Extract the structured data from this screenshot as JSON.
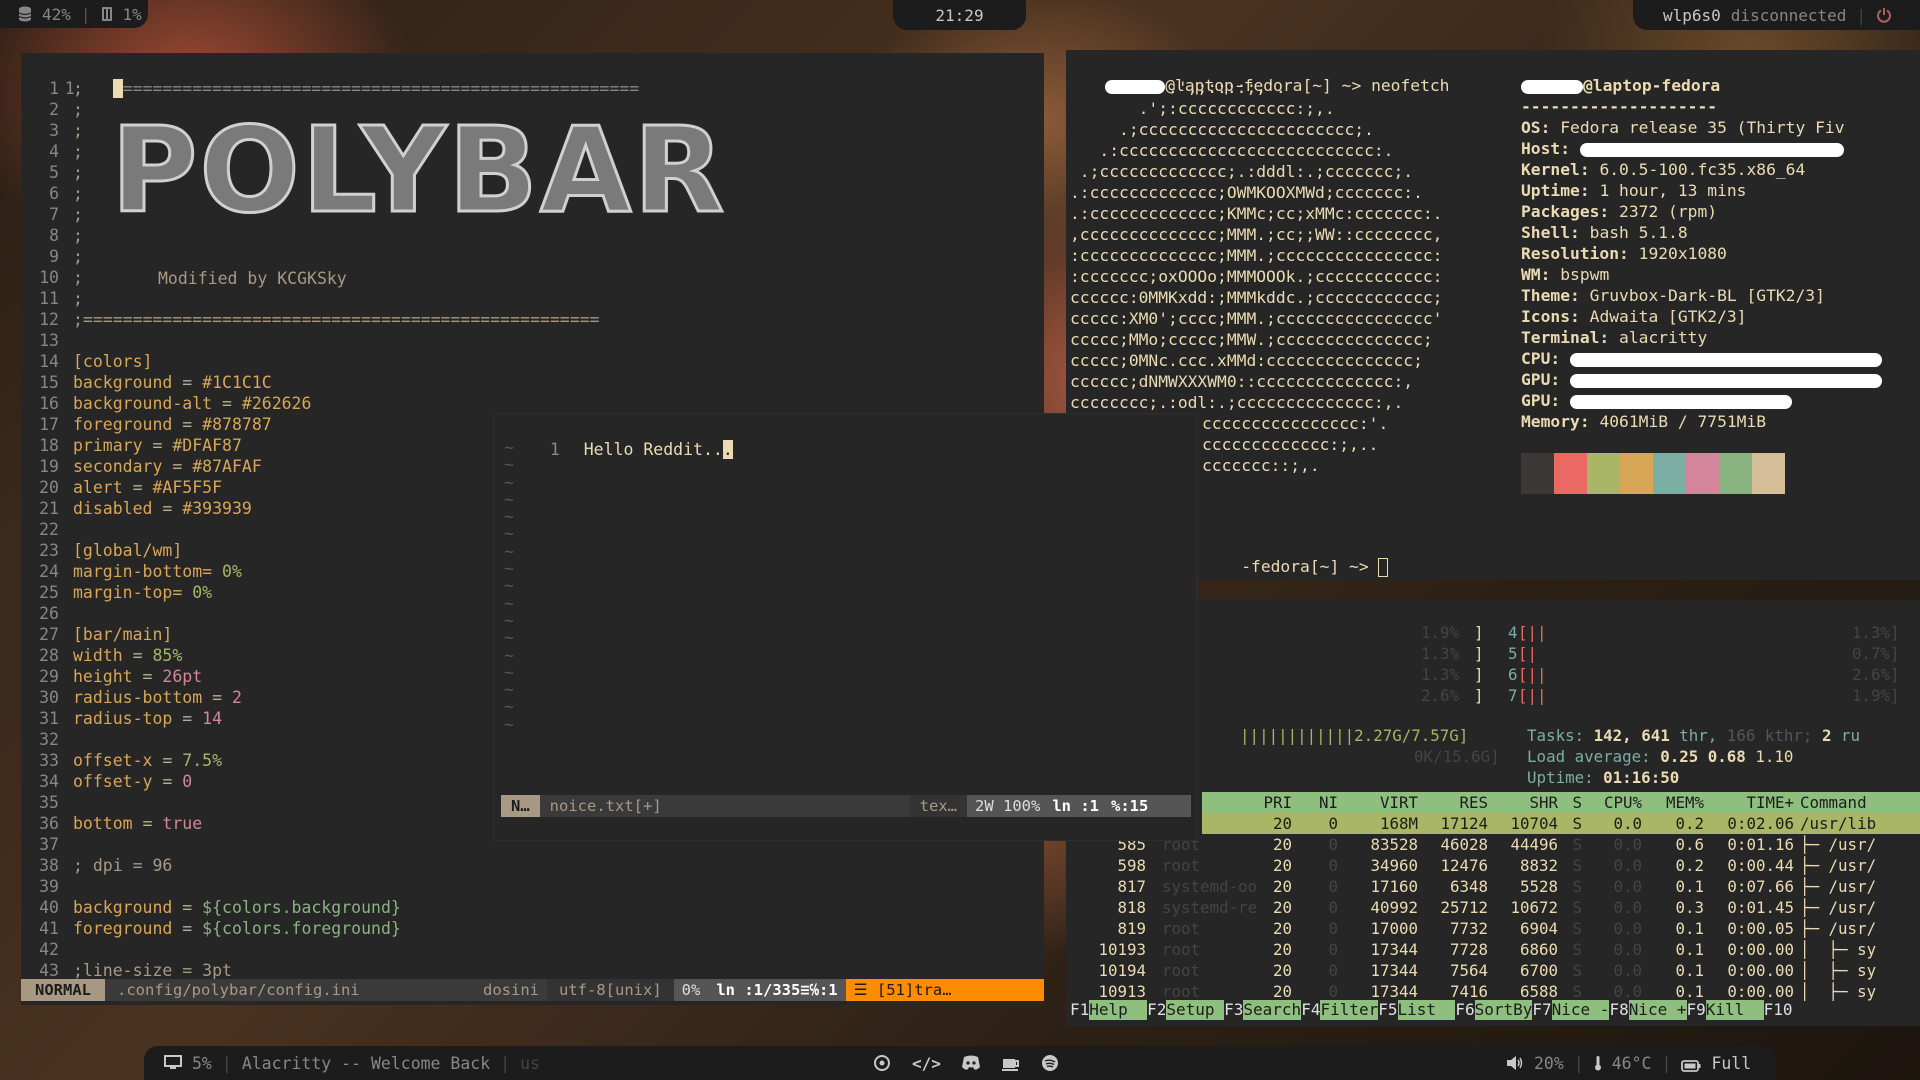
{
  "topbar": {
    "disk_pct": "42%",
    "mem_pct": "1%",
    "clock": "21:29",
    "network": "wlp6s0",
    "network_state": "disconnected"
  },
  "editor": {
    "header_line_number": "1",
    "header_rule": "====================================================",
    "art_text": "POLYBAR",
    "modified_by": "Modified by KCGKSky",
    "lines": [
      {
        "n": "1",
        "t": ";"
      },
      {
        "n": "2",
        "t": ";"
      },
      {
        "n": "3",
        "t": ";"
      },
      {
        "n": "4",
        "t": ";"
      },
      {
        "n": "5",
        "t": ";"
      },
      {
        "n": "6",
        "t": ";"
      },
      {
        "n": "7",
        "t": ";"
      },
      {
        "n": "8",
        "t": ";"
      },
      {
        "n": "9",
        "t": ";"
      },
      {
        "n": "10",
        "t": ";"
      },
      {
        "n": "11",
        "t": ";"
      },
      {
        "n": "12",
        "t": ";===================================================="
      },
      {
        "n": "13",
        "t": ""
      },
      {
        "n": "14",
        "t": "[colors]"
      },
      {
        "n": "15",
        "key": "background",
        "val": "#1C1C1C"
      },
      {
        "n": "16",
        "key": "background-alt",
        "val": "#262626"
      },
      {
        "n": "17",
        "key": "foreground",
        "val": "#878787"
      },
      {
        "n": "18",
        "key": "primary",
        "val": "#DFAF87"
      },
      {
        "n": "19",
        "key": "secondary",
        "val": "#87AFAF"
      },
      {
        "n": "20",
        "key": "alert",
        "val": "#AF5F5F"
      },
      {
        "n": "21",
        "key": "disabled",
        "val": "#393939"
      },
      {
        "n": "22",
        "t": ""
      },
      {
        "n": "23",
        "t": "[global/wm]"
      },
      {
        "n": "24",
        "key": "margin-bottom=",
        "val": "0%"
      },
      {
        "n": "25",
        "key": "margin-top=",
        "val": "0%"
      },
      {
        "n": "26",
        "t": ""
      },
      {
        "n": "27",
        "t": "[bar/main]"
      },
      {
        "n": "28",
        "key": "width",
        "val": "85%"
      },
      {
        "n": "29",
        "key": "height",
        "val": "26pt"
      },
      {
        "n": "30",
        "key": "radius-bottom",
        "val": "2"
      },
      {
        "n": "31",
        "key": "radius-top",
        "val": "14"
      },
      {
        "n": "32",
        "t": ""
      },
      {
        "n": "33",
        "key": "offset-x",
        "val": "7.5%"
      },
      {
        "n": "34",
        "key": "offset-y",
        "val": "0"
      },
      {
        "n": "35",
        "t": ""
      },
      {
        "n": "36",
        "key": "bottom",
        "val": "true"
      },
      {
        "n": "37",
        "t": ""
      },
      {
        "n": "38",
        "t": "; dpi = 96"
      },
      {
        "n": "39",
        "t": ""
      },
      {
        "n": "40",
        "key": "background",
        "val": "${colors.background}"
      },
      {
        "n": "41",
        "key": "foreground",
        "val": "${colors.foreground}"
      },
      {
        "n": "42",
        "t": ""
      },
      {
        "n": "43",
        "t": ";line-size = 3pt"
      }
    ],
    "status": {
      "mode": "NORMAL",
      "file": ".config/polybar/config.ini",
      "filetype": "dosini",
      "encoding": "utf-8[unix]",
      "percent": "0%",
      "position": "ln :1/335≡℅:1",
      "warning": "☰ [51]tra…"
    }
  },
  "float_editor": {
    "line_number": "1",
    "text": "Hello Reddit..",
    "cursor_char": ".",
    "tilde": "~",
    "status": {
      "mode": "N…",
      "file": "noice.txt[+]",
      "filetype": "tex…",
      "info": "2W 100%",
      "position": "ln :1",
      "col": "%:15"
    }
  },
  "neofetch": {
    "prompt": "@laptop-fedora[~] ~> neofetch",
    "prompt2": "-fedora[~] ~>",
    "userhost": "@laptop-fedora",
    "separator": "--------------------",
    "logo": [
      "          .',;::::;,'.",
      "       .';:cccccccccccc:;,.",
      "     .;cccccccccccccccccccccc;.",
      "   .:cccccccccccccccccccccccccc:.",
      " .;ccccccccccccc;.:dddl:.;ccccccc;.",
      ".:ccccccccccccc;OWMKOOXMWd;ccccccc:.",
      ".:ccccccccccccc;KMMc;cc;xMMc:ccccccc:.",
      ",cccccccccccccc;MMM.;cc;;WW::cccccccc,",
      ":cccccccccccccc;MMM.;cccccccccccccccc:",
      ":ccccccc;oxOOOo;MMMOOOk.;cccccccccccc:",
      "cccccc:0MMKxdd:;MMMkddc.;cccccccccccc;",
      "ccccc:XM0';cccc;MMM.;cccccccccccccccc'",
      "ccccc;MMo;ccccc;MMW.;ccccccccccccccc;",
      "ccccc;0MNc.ccc.xMMd:ccccccccccccccc;",
      "cccccc;dNMWXXXWM0::cccccccccccccc:,",
      "cccccccc;.:odl:.;cccccccccccccc:,."
    ],
    "logo_tail": [
      "cccccccccccccccc:'.",
      "ccccccccccccc:;,..",
      "ccccccc::;,."
    ],
    "info": [
      {
        "label": "OS:",
        "val": "Fedora release 35 (Thirty Fiv"
      },
      {
        "label": "Host:",
        "val": ""
      },
      {
        "label": "Kernel:",
        "val": "6.0.5-100.fc35.x86_64"
      },
      {
        "label": "Uptime:",
        "val": "1 hour, 13 mins"
      },
      {
        "label": "Packages:",
        "val": "2372 (rpm)"
      },
      {
        "label": "Shell:",
        "val": "bash 5.1.8"
      },
      {
        "label": "Resolution:",
        "val": "1920x1080"
      },
      {
        "label": "WM:",
        "val": "bspwm"
      },
      {
        "label": "Theme:",
        "val": "Gruvbox-Dark-BL [GTK2/3]"
      },
      {
        "label": "Icons:",
        "val": "Adwaita [GTK2/3]"
      },
      {
        "label": "Terminal:",
        "val": "alacritty"
      },
      {
        "label": "CPU:",
        "val": ""
      },
      {
        "label": "GPU:",
        "val": ""
      },
      {
        "label": "GPU:",
        "val": ""
      },
      {
        "label": "Memory:",
        "val": "4061MiB / 7751MiB"
      }
    ],
    "palette": [
      "#3c3836",
      "#ea6962",
      "#a9b665",
      "#d8a657",
      "#7daea3",
      "#d3869b",
      "#89b482",
      "#d4be98"
    ]
  },
  "htop": {
    "cpu_left": [
      {
        "pct": "1.9%"
      },
      {
        "pct": "1.3%"
      },
      {
        "pct": "1.3%"
      },
      {
        "pct": "2.6%"
      }
    ],
    "cpu_right": [
      {
        "id": "4",
        "bar": "[||",
        "pct": "1.3%]"
      },
      {
        "id": "5",
        "bar": "[|",
        "pct": "0.7%]"
      },
      {
        "id": "6",
        "bar": "[||",
        "pct": "2.6%]"
      },
      {
        "id": "7",
        "bar": "[||",
        "pct": "1.9%]"
      }
    ],
    "mem_bar": "||||||||||||2.27G/7.57G]",
    "swp": "0K/15.6G]",
    "tasks_label": "Tasks:",
    "tasks": "142,",
    "thr": "641",
    "thr_label": "thr,",
    "kthr": "166 kthr;",
    "running": "2",
    "running_label": "ru",
    "load_label": "Load average:",
    "load1": "0.25",
    "load5": "0.68",
    "load15": "1.10",
    "uptime_label": "Uptime:",
    "uptime": "01:16:50",
    "columns": [
      "PRI",
      "NI",
      "VIRT",
      "RES",
      "SHR",
      "S",
      "CPU%",
      "MEM%",
      "TIME+",
      "Command"
    ],
    "rows": [
      {
        "pid": "",
        "user": "",
        "pri": "20",
        "ni": "0",
        "virt": "168M",
        "res": "17124",
        "shr": "10704",
        "s": "S",
        "cpu": "0.0",
        "mem": "0.2",
        "time": "0:02.06",
        "cmd": "/usr/lib"
      },
      {
        "pid": "585",
        "user": "root",
        "pri": "20",
        "ni": "0",
        "virt": "83528",
        "res": "46028",
        "shr": "44496",
        "s": "S",
        "cpu": "0.0",
        "mem": "0.6",
        "time": "0:01.16",
        "cmd": "├─ /usr/"
      },
      {
        "pid": "598",
        "user": "root",
        "pri": "20",
        "ni": "0",
        "virt": "34960",
        "res": "12476",
        "shr": "8832",
        "s": "S",
        "cpu": "0.0",
        "mem": "0.2",
        "time": "0:00.44",
        "cmd": "├─ /usr/"
      },
      {
        "pid": "817",
        "user": "systemd-oo",
        "pri": "20",
        "ni": "0",
        "virt": "17160",
        "res": "6348",
        "shr": "5528",
        "s": "S",
        "cpu": "0.0",
        "mem": "0.1",
        "time": "0:07.66",
        "cmd": "├─ /usr/"
      },
      {
        "pid": "818",
        "user": "systemd-re",
        "pri": "20",
        "ni": "0",
        "virt": "40992",
        "res": "25712",
        "shr": "10672",
        "s": "S",
        "cpu": "0.0",
        "mem": "0.3",
        "time": "0:01.45",
        "cmd": "├─ /usr/"
      },
      {
        "pid": "819",
        "user": "root",
        "pri": "20",
        "ni": "0",
        "virt": "17000",
        "res": "7732",
        "shr": "6904",
        "s": "S",
        "cpu": "0.0",
        "mem": "0.1",
        "time": "0:00.05",
        "cmd": "├─ /usr/"
      },
      {
        "pid": "10193",
        "user": "root",
        "pri": "20",
        "ni": "0",
        "virt": "17344",
        "res": "7728",
        "shr": "6860",
        "s": "S",
        "cpu": "0.0",
        "mem": "0.1",
        "time": "0:00.00",
        "cmd": "│  ├─ sy"
      },
      {
        "pid": "10194",
        "user": "root",
        "pri": "20",
        "ni": "0",
        "virt": "17344",
        "res": "7564",
        "shr": "6700",
        "s": "S",
        "cpu": "0.0",
        "mem": "0.1",
        "time": "0:00.00",
        "cmd": "│  ├─ sy"
      },
      {
        "pid": "10913",
        "user": "root",
        "pri": "20",
        "ni": "0",
        "virt": "17344",
        "res": "7416",
        "shr": "6588",
        "s": "S",
        "cpu": "0.0",
        "mem": "0.1",
        "time": "0:00.00",
        "cmd": "│  ├─ sy"
      }
    ],
    "fkeys": [
      {
        "n": "F1",
        "l": "Help  "
      },
      {
        "n": "F2",
        "l": "Setup "
      },
      {
        "n": "F3",
        "l": "Search"
      },
      {
        "n": "F4",
        "l": "Filter"
      },
      {
        "n": "F5",
        "l": "List  "
      },
      {
        "n": "F6",
        "l": "SortBy"
      },
      {
        "n": "F7",
        "l": "Nice -"
      },
      {
        "n": "F8",
        "l": "Nice +"
      },
      {
        "n": "F9",
        "l": "Kill  "
      },
      {
        "n": "F10",
        "l": ""
      }
    ]
  },
  "bottombar": {
    "cpu_pct": "5%",
    "window_title": "Alacritty -- Welcome Back",
    "layout": "us",
    "volume": "20%",
    "temp": "46°C",
    "battery": "Full"
  }
}
